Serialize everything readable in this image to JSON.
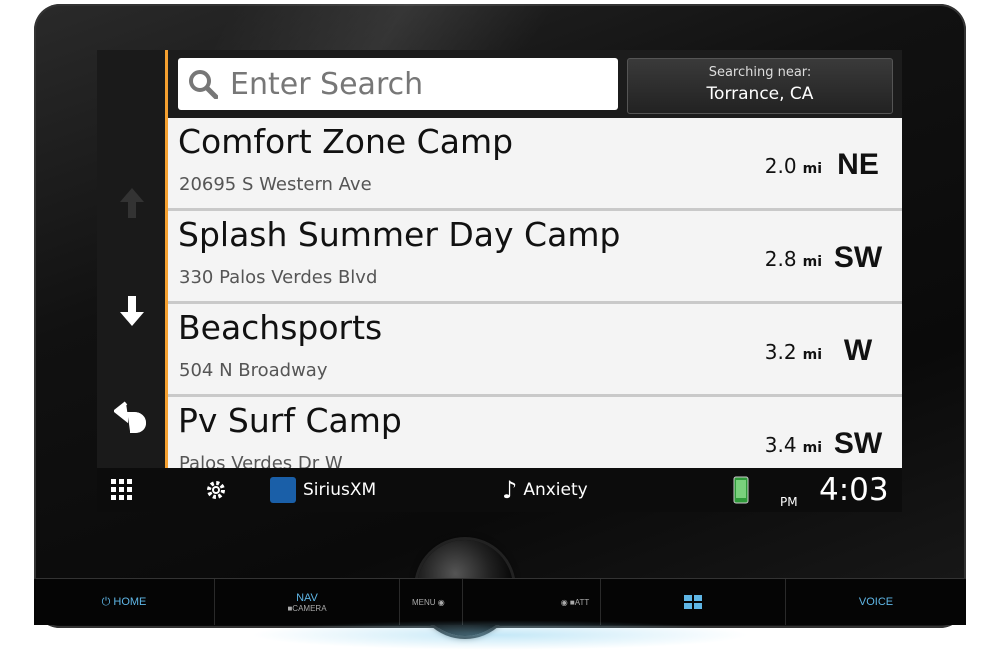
{
  "search": {
    "placeholder": "Enter Search"
  },
  "near": {
    "label": "Searching near:",
    "city": "Torrance, CA"
  },
  "results": [
    {
      "name": "Comfort Zone Camp",
      "address": "20695 S Western Ave",
      "distance": "2.0",
      "unit": "mi",
      "direction": "NE"
    },
    {
      "name": "Splash Summer Day Camp",
      "address": "330 Palos Verdes Blvd",
      "distance": "2.8",
      "unit": "mi",
      "direction": "SW"
    },
    {
      "name": "Beachsports",
      "address": "504 N Broadway",
      "distance": "3.2",
      "unit": "mi",
      "direction": "W"
    },
    {
      "name": "Pv Surf Camp",
      "address": "Palos Verdes Dr W",
      "distance": "3.4",
      "unit": "mi",
      "direction": "SW"
    }
  ],
  "statusbar": {
    "source": "SiriusXM",
    "track": "Anxiety",
    "ampm": "PM",
    "time": "4:03"
  },
  "hardware": {
    "home": "HOME",
    "nav": "NAV",
    "camera": "CAMERA",
    "menu": "MENU",
    "att": "ATT",
    "voice": "VOICE"
  },
  "icons": {
    "scroll_up": "arrow-up-icon",
    "scroll_down": "arrow-down-icon",
    "back": "back-icon",
    "apps": "grid-icon",
    "settings": "gear-icon",
    "search": "search-icon",
    "music": "music-note-icon",
    "phone": "phone-icon"
  },
  "colors": {
    "accent": "#f5a030",
    "hw_label": "#5fb6e6"
  }
}
